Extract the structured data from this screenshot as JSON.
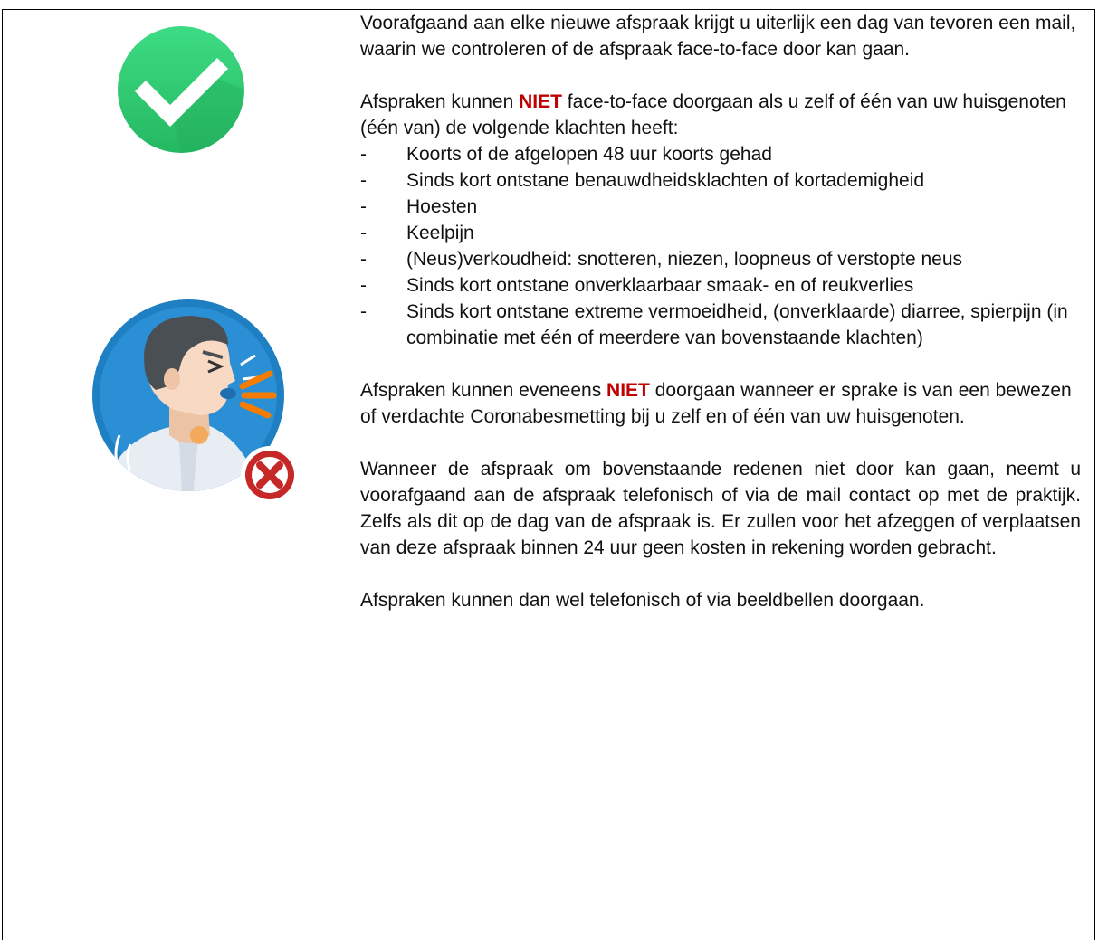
{
  "intro": "Voorafgaand aan elke nieuwe afspraak krijgt u uiterlijk een dag van tevoren een mail, waarin we controleren of de afspraak face-to-face door kan gaan.",
  "rule1": {
    "before": "Afspraken kunnen ",
    "emphasis": "NIET",
    "after": " face-to-face doorgaan als u zelf of één van uw huisgenoten (één van) de volgende klachten heeft:"
  },
  "symptoms": [
    "Koorts of de afgelopen 48 uur koorts gehad",
    "Sinds kort ontstane benauwdheidsklachten of kortademigheid",
    "Hoesten",
    "Keelpijn",
    "(Neus)verkoudheid: snotteren, niezen, loopneus of verstopte neus",
    "Sinds kort ontstane onverklaarbaar smaak- en of reukverlies",
    "Sinds kort ontstane extreme vermoeidheid, (onverklaarde) diarree, spierpijn (in combinatie met één of meerdere van bovenstaande klachten)"
  ],
  "bullet": "-",
  "rule2": {
    "before": "Afspraken kunnen eveneens ",
    "emphasis": "NIET",
    "after": " doorgaan wanneer er sprake is van een bewezen of verdachte Coronabesmetting bij u zelf en of één van uw huisgenoten."
  },
  "cancel_text": "Wanneer de afspraak om bovenstaande redenen niet door kan gaan, neemt u voorafgaand aan de afspraak telefonisch of via de mail contact op met de praktijk. Zelfs als dit op de dag van de afspraak is. Er zullen voor het afzeggen of verplaatsen van deze afspraak binnen 24 uur geen kosten in rekening worden gebracht.",
  "alternative": "Afspraken kunnen dan wel telefonisch of via beeldbellen doorgaan.",
  "colors": {
    "niet": "#c00000",
    "check_green": "#2ecc71",
    "cross_red": "#c62828",
    "skin": "#f7d9c4",
    "hair": "#4a4f54",
    "circle_blue": "#1e7fc2"
  },
  "icons": [
    "check-circle-icon",
    "coughing-person-icon",
    "cross-circle-icon"
  ]
}
